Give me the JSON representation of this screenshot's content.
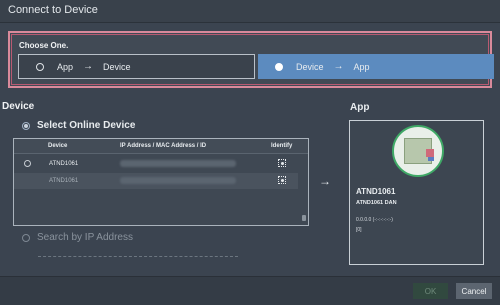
{
  "window": {
    "title": "Connect to Device"
  },
  "choose": {
    "label": "Choose One.",
    "option_app_to_device": {
      "from": "App",
      "arrow": "→",
      "to": "Device"
    },
    "option_device_to_app": {
      "from": "Device",
      "arrow": "→",
      "to": "App",
      "selected": true
    }
  },
  "device": {
    "title": "Device",
    "select_online_label": "Select Online Device",
    "table": {
      "headers": [
        "Device",
        "IP Address / MAC Address / ID",
        "Identify"
      ],
      "rows": [
        {
          "name": "ATND1061"
        },
        {
          "name": "ATND1061"
        }
      ]
    },
    "search_by_ip_label": "Search by IP Address"
  },
  "app": {
    "title": "App",
    "name": "ATND1061",
    "subtitle": "ATND1061 DAN",
    "version": "0.0.0.0 (-:-:-:-:-:-)",
    "id": "[0]"
  },
  "footer": {
    "ok_label": "OK",
    "cancel_label": "Cancel"
  },
  "colors": {
    "accent": "#5c8bbf",
    "highlight_border": "#d98a9b",
    "device_ring": "#3fa866"
  }
}
